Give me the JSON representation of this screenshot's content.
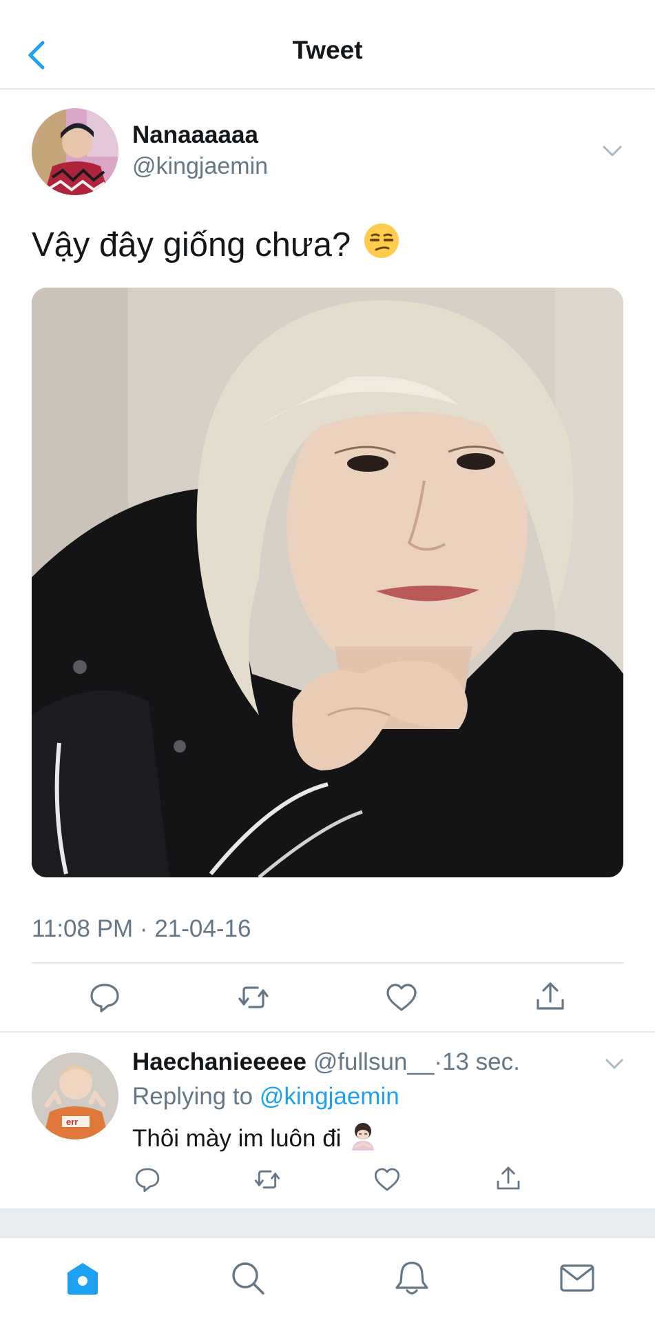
{
  "header": {
    "title": "Tweet",
    "back_icon": "chevron-left-icon"
  },
  "tweet": {
    "author_name": "Nanaaaaaa",
    "author_handle": "@kingjaemin",
    "text": "Vậy đây giống chưa?",
    "emoji": "😒",
    "timestamp": "11:08 PM · 21-04-16",
    "actions": [
      "reply-icon",
      "retweet-icon",
      "like-icon",
      "share-icon"
    ]
  },
  "reply": {
    "author_name": "Haechanieeeee",
    "author_handle": "@fullsun__",
    "separator": "·",
    "time": "13 sec.",
    "replying_prefix": "Replying to",
    "replying_to": "@kingjaemin",
    "text": "Thôi mày im luôn đi",
    "emoji": "🙇‍♀️"
  },
  "bottom_nav": [
    "home-icon",
    "search-icon",
    "notifications-icon",
    "messages-icon"
  ],
  "colors": {
    "accent": "#1da1f2",
    "secondary_text": "#657786",
    "divider": "#e1e8ed"
  }
}
